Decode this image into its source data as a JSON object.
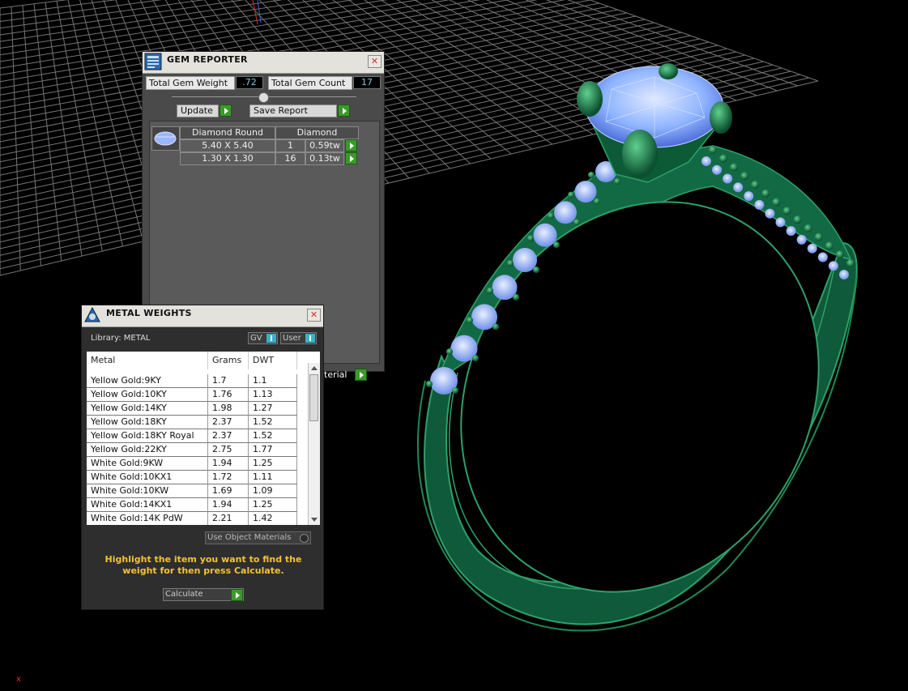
{
  "gem_reporter": {
    "title": "GEM REPORTER",
    "total_weight_label": "Total Gem Weight",
    "total_weight_value": ".72",
    "total_count_label": "Total Gem Count",
    "total_count_value": "17",
    "update_label": "Update",
    "save_report_label": "Save Report",
    "header_shape": "Diamond Round",
    "header_material": "Diamond",
    "rows": [
      {
        "size": "5.40 X 5.40",
        "qty": "1",
        "weight": "0.59tw"
      },
      {
        "size": "1.30 X 1.30",
        "qty": "16",
        "weight": "0.13tw"
      }
    ]
  },
  "metal_weights": {
    "title": "METAL WEIGHTS",
    "library_label": "Library: METAL",
    "toggle_gv": "GV",
    "toggle_user": "User",
    "columns": [
      "Metal",
      "Grams",
      "DWT"
    ],
    "rows": [
      {
        "metal": "Yellow Gold:9KY",
        "grams": "1.7",
        "dwt": "1.1"
      },
      {
        "metal": "Yellow Gold:10KY",
        "grams": "1.76",
        "dwt": "1.13"
      },
      {
        "metal": "Yellow Gold:14KY",
        "grams": "1.98",
        "dwt": "1.27"
      },
      {
        "metal": "Yellow Gold:18KY",
        "grams": "2.37",
        "dwt": "1.52"
      },
      {
        "metal": "Yellow Gold:18KY Royal",
        "grams": "2.37",
        "dwt": "1.52"
      },
      {
        "metal": "Yellow Gold:22KY",
        "grams": "2.75",
        "dwt": "1.77"
      },
      {
        "metal": "White Gold:9KW",
        "grams": "1.94",
        "dwt": "1.25"
      },
      {
        "metal": "White Gold:10KX1",
        "grams": "1.72",
        "dwt": "1.11"
      },
      {
        "metal": "White Gold:10KW",
        "grams": "1.69",
        "dwt": "1.09"
      },
      {
        "metal": "White Gold:14KX1",
        "grams": "1.94",
        "dwt": "1.25"
      },
      {
        "metal": "White Gold:14K PdW",
        "grams": "2.21",
        "dwt": "1.42"
      }
    ],
    "use_object_materials": "Use Object Materials",
    "hint": "Highlight the item you want to find the weight for then press Calculate.",
    "calculate_label": "Calculate"
  },
  "behind_fragment": "terial",
  "colors": {
    "ring_green": "#15704a",
    "gem_blue": "#8fb4ff",
    "hint_yellow": "#f3c235",
    "grid_line": "#8a8a8a"
  }
}
